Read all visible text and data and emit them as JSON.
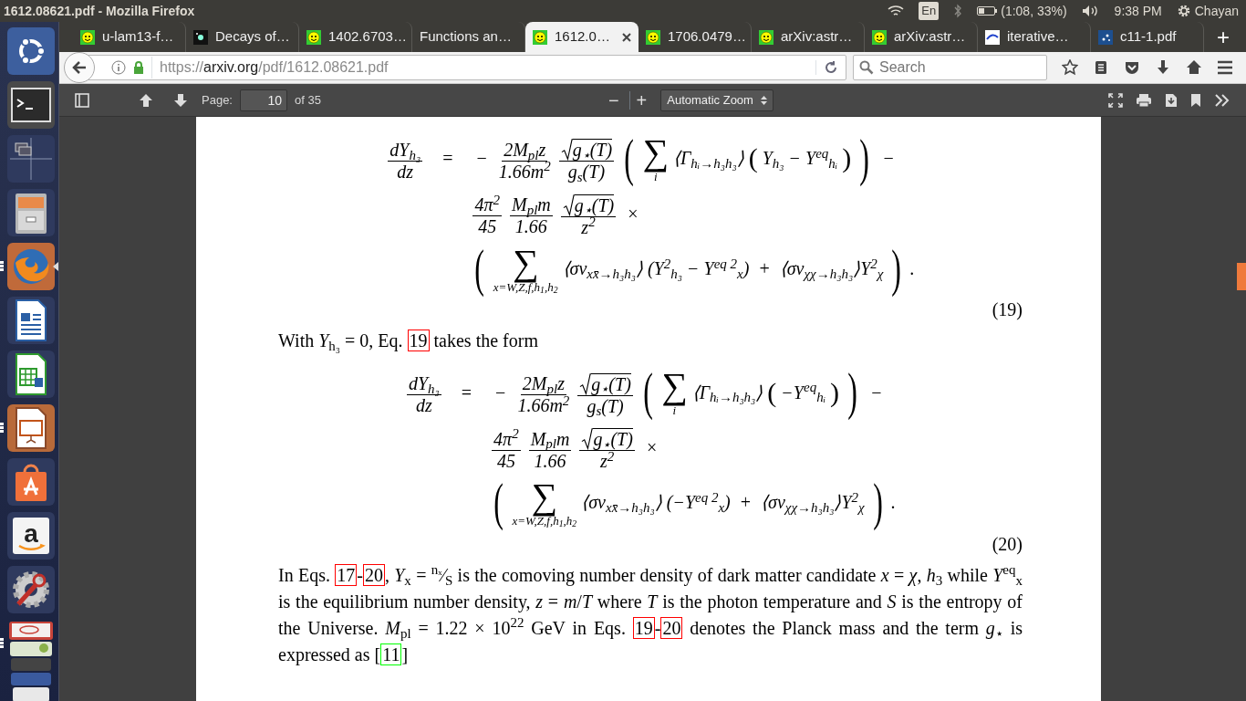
{
  "top_panel": {
    "title": "1612.08621.pdf - Mozilla Firefox",
    "keyboard": "En",
    "battery": "(1:08, 33%)",
    "clock": "9:38 PM",
    "user": "Chayan"
  },
  "launcher": [
    {
      "kind": "ubuntu",
      "running": false,
      "focused": false
    },
    {
      "kind": "terminal",
      "running": false,
      "focused": false
    },
    {
      "kind": "workspaces",
      "running": false,
      "focused": false
    },
    {
      "kind": "files",
      "running": false,
      "focused": false
    },
    {
      "kind": "firefox",
      "running": true,
      "focused": true
    },
    {
      "kind": "writer",
      "running": false,
      "focused": false
    },
    {
      "kind": "calc",
      "running": false,
      "focused": false
    },
    {
      "kind": "impress",
      "running": true,
      "focused": false
    },
    {
      "kind": "software",
      "running": false,
      "focused": false
    },
    {
      "kind": "amazon",
      "glyph": "a",
      "running": false,
      "focused": false
    },
    {
      "kind": "settings",
      "running": false,
      "focused": false
    },
    {
      "kind": "stack",
      "running": true,
      "focused": false
    }
  ],
  "tabs": [
    {
      "label": "u-lam13-f…",
      "kind": "smiley",
      "selected": false
    },
    {
      "label": "Decays of…",
      "kind": "galaxy",
      "selected": false
    },
    {
      "label": "1402.6703…",
      "kind": "smiley",
      "selected": false
    },
    {
      "label": "Functions an…",
      "kind": "plain",
      "selected": false
    },
    {
      "label": "1612.0…",
      "kind": "smiley",
      "selected": true
    },
    {
      "label": "1706.0479…",
      "kind": "smiley",
      "selected": false
    },
    {
      "label": "arXiv:astr…",
      "kind": "smiley",
      "selected": false
    },
    {
      "label": "arXiv:astr…",
      "kind": "smiley",
      "selected": false
    },
    {
      "label": "iterative…",
      "kind": "cmi",
      "selected": false
    },
    {
      "label": "c11-1.pdf",
      "kind": "pdf",
      "selected": false
    }
  ],
  "new_tab": "+",
  "address_bar": {
    "scheme": "https://",
    "host": "arxiv.org",
    "path": "/pdf/1612.08621.pdf"
  },
  "search": {
    "placeholder": "Search"
  },
  "pdf_toolbar": {
    "page_label": "Page:",
    "page": "10",
    "page_count": "of 35",
    "zoom_out": "−",
    "zoom_in": "+",
    "zoom": "Automatic Zoom"
  },
  "document": [
    {
      "kind": "equation",
      "lhs": [
        {
          "kind": "frac",
          "num": "dY$_{h₃}$",
          "den": "dz",
          "sqrt": false
        }
      ],
      "relation": "=",
      "lines": [
        {
          "parts": [
            {
              "kind": "op",
              "text": "−"
            },
            {
              "kind": "frac",
              "num": "2M$_{pl}$z",
              "den": "1.66m$^{2}$",
              "sqrt": false
            },
            {
              "kind": "frac",
              "num": "g$_{⋆}$(T)",
              "den": "g$_{s}$(T)",
              "sqrt": true
            },
            {
              "kind": "bigparen",
              "text": "("
            },
            {
              "kind": "sum",
              "symbol": "∑",
              "below": "i"
            },
            {
              "kind": "text",
              "text": "⟨Γ$_{hᵢ→h₃h₃}$⟩"
            },
            {
              "kind": "paren",
              "text": "("
            },
            {
              "kind": "text",
              "text": "Y$_{h₃}$ − Y$^{eq}$$_{hᵢ}$"
            },
            {
              "kind": "paren",
              "text": ")"
            },
            {
              "kind": "bigparen",
              "text": ")"
            },
            {
              "kind": "op",
              "text": "−"
            }
          ]
        },
        {
          "parts": [
            {
              "kind": "frac",
              "num": "4π$^{2}$",
              "den": "45",
              "sqrt": false
            },
            {
              "kind": "frac",
              "num": "M$_{pl}$m",
              "den": "1.66",
              "sqrt": false
            },
            {
              "kind": "frac",
              "num": "g$_{⋆}$(T)",
              "den": "z$^{2}$",
              "sqrt": true
            },
            {
              "kind": "op",
              "text": "×"
            }
          ]
        },
        {
          "parts": [
            {
              "kind": "bigparen",
              "text": "("
            },
            {
              "kind": "sum",
              "symbol": "∑",
              "below": "x=W,Z,f,h$_{1}$,h$_{2}$"
            },
            {
              "kind": "text",
              "text": "⟨σv$_{xx̄→h₃h₃}$⟩"
            },
            {
              "kind": "text",
              "text": "(Y$^{2}$$_{h₃}$ − Y$^{eq 2}$$_{x}$)"
            },
            {
              "kind": "op",
              "text": "+"
            },
            {
              "kind": "text",
              "text": "⟨σv$_{χχ→h₃h₃}$⟩Y$^{2}$$_{χ}$"
            },
            {
              "kind": "bigparen",
              "text": ")"
            },
            {
              "kind": "text",
              "text": "."
            }
          ]
        }
      ],
      "number": "(19)"
    },
    {
      "kind": "paragraph",
      "parts": [
        {
          "kind": "text",
          "text": "With *Y*$_{h₃}$ = 0, Eq. "
        },
        {
          "kind": "eqref",
          "text": "19"
        },
        {
          "kind": "text",
          "text": " takes the form"
        }
      ]
    },
    {
      "kind": "equation",
      "lhs": [
        {
          "kind": "frac",
          "num": "dY$_{h₃}$",
          "den": "dz",
          "sqrt": false
        }
      ],
      "relation": "=",
      "lines": [
        {
          "parts": [
            {
              "kind": "op",
              "text": "−"
            },
            {
              "kind": "frac",
              "num": "2M$_{pl}$z",
              "den": "1.66m$^{2}$",
              "sqrt": false
            },
            {
              "kind": "frac",
              "num": "g$_{⋆}$(T)",
              "den": "g$_{s}$(T)",
              "sqrt": true
            },
            {
              "kind": "bigparen",
              "text": "("
            },
            {
              "kind": "sum",
              "symbol": "∑",
              "below": "i"
            },
            {
              "kind": "text",
              "text": "⟨Γ$_{hᵢ→h₃h₃}$⟩"
            },
            {
              "kind": "paren",
              "text": "("
            },
            {
              "kind": "text",
              "text": "−Y$^{eq}$$_{hᵢ}$"
            },
            {
              "kind": "paren",
              "text": ")"
            },
            {
              "kind": "bigparen",
              "text": ")"
            },
            {
              "kind": "op",
              "text": "−"
            }
          ]
        },
        {
          "parts": [
            {
              "kind": "frac",
              "num": "4π$^{2}$",
              "den": "45",
              "sqrt": false
            },
            {
              "kind": "frac",
              "num": "M$_{pl}$m",
              "den": "1.66",
              "sqrt": false
            },
            {
              "kind": "frac",
              "num": "g$_{⋆}$(T)",
              "den": "z$^{2}$",
              "sqrt": true
            },
            {
              "kind": "op",
              "text": "×"
            }
          ]
        },
        {
          "parts": [
            {
              "kind": "bigparen",
              "text": "("
            },
            {
              "kind": "sum",
              "symbol": "∑",
              "below": "x=W,Z,f,h$_{1}$,h$_{2}$"
            },
            {
              "kind": "text",
              "text": "⟨σv$_{xx̄→h₃h₃}$⟩"
            },
            {
              "kind": "text",
              "text": "(−Y$^{eq 2}$$_{x}$)"
            },
            {
              "kind": "op",
              "text": "+"
            },
            {
              "kind": "text",
              "text": "⟨σv$_{χχ→h₃h₃}$⟩Y$^{2}$$_{χ}$"
            },
            {
              "kind": "bigparen",
              "text": ")"
            },
            {
              "kind": "text",
              "text": "."
            }
          ]
        }
      ],
      "number": "(20)"
    },
    {
      "kind": "paragraph",
      "parts": [
        {
          "kind": "text",
          "text": "In Eqs. "
        },
        {
          "kind": "eqref",
          "text": "17"
        },
        {
          "kind": "text",
          "text": "-"
        },
        {
          "kind": "eqref",
          "text": "20"
        },
        {
          "kind": "text",
          "text": ", *Y*$_{x}$ = $^{nₓ}$⁄$_{S}$ is the comoving number density of dark matter candidate *x* = *χ*, *h*$_{3}$ while *Y*$^{eq}$$_{x}$ is the equilibrium number density, *z* = *m*/*T* where *T* is the photon temperature and *S* is the entropy of the Universe. *M*$_{pl}$ = 1.22 × 10$^{22}$ GeV in Eqs. "
        },
        {
          "kind": "eqref",
          "text": "19"
        },
        {
          "kind": "text",
          "text": "-"
        },
        {
          "kind": "eqref",
          "text": "20"
        },
        {
          "kind": "text",
          "text": " denotes the Planck mass and the term *g*$_{⋆}$ is expressed as ["
        },
        {
          "kind": "cite",
          "text": "11"
        },
        {
          "kind": "text",
          "text": "]"
        }
      ]
    }
  ]
}
